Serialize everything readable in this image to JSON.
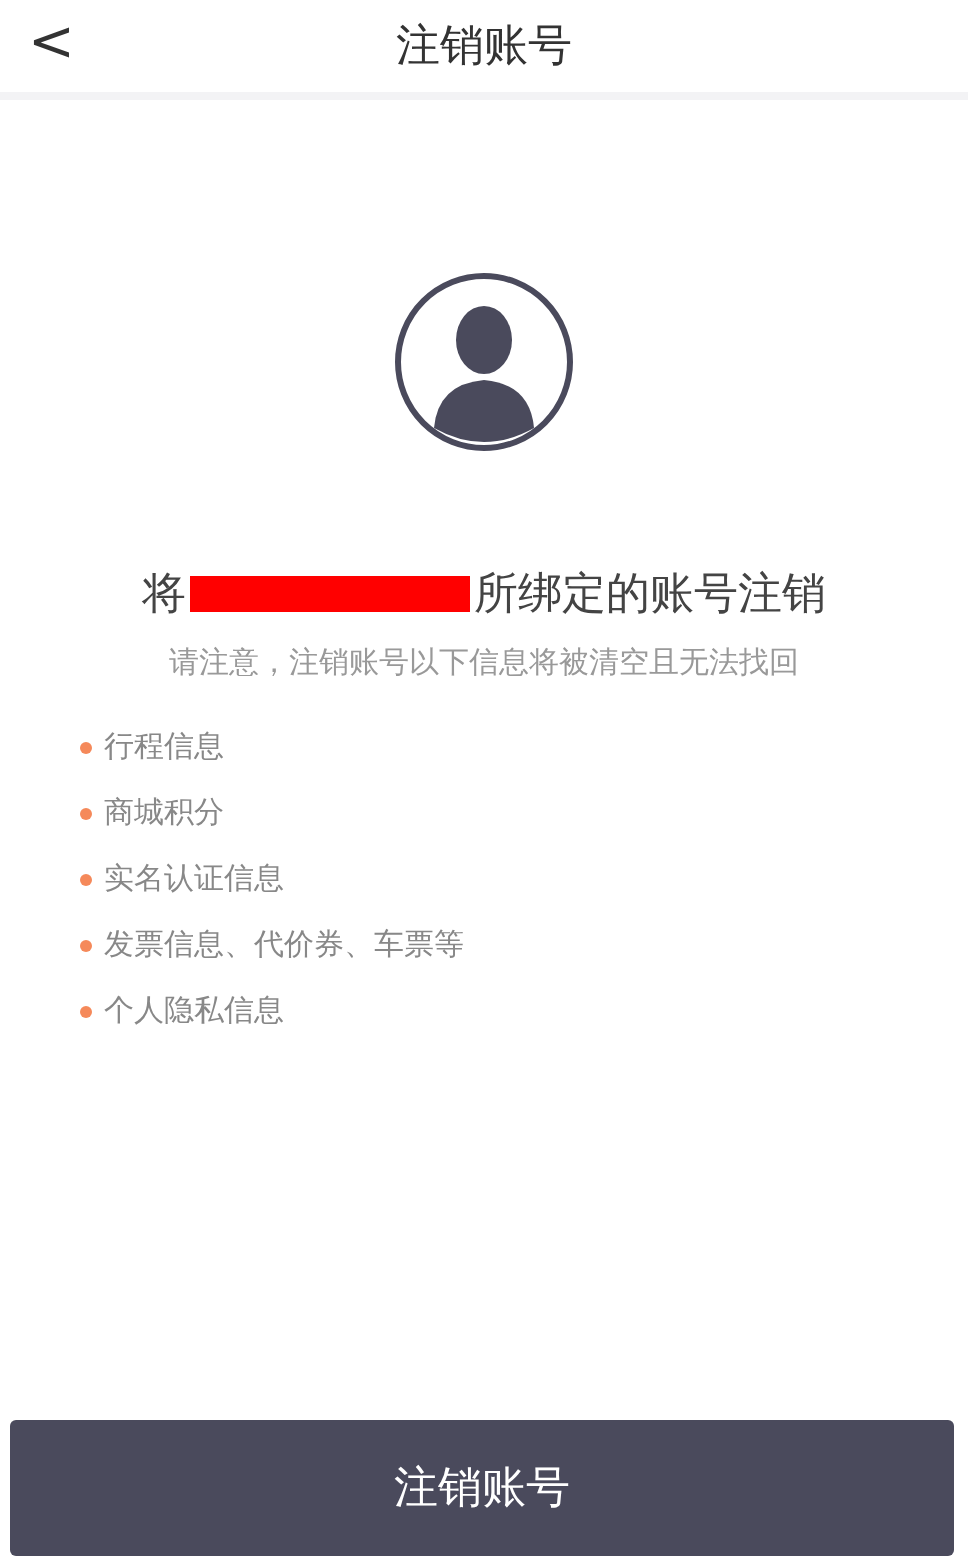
{
  "header": {
    "back": "<",
    "title": "注销账号"
  },
  "heading": {
    "prefix": "将",
    "redacted": true,
    "suffix": "所绑定的账号注销"
  },
  "notice": "请注意，注销账号以下信息将被清空且无法找回",
  "items": [
    "行程信息",
    "商城积分",
    "实名认证信息",
    "发票信息、代价券、车票等",
    "个人隐私信息"
  ],
  "button": "注销账号"
}
